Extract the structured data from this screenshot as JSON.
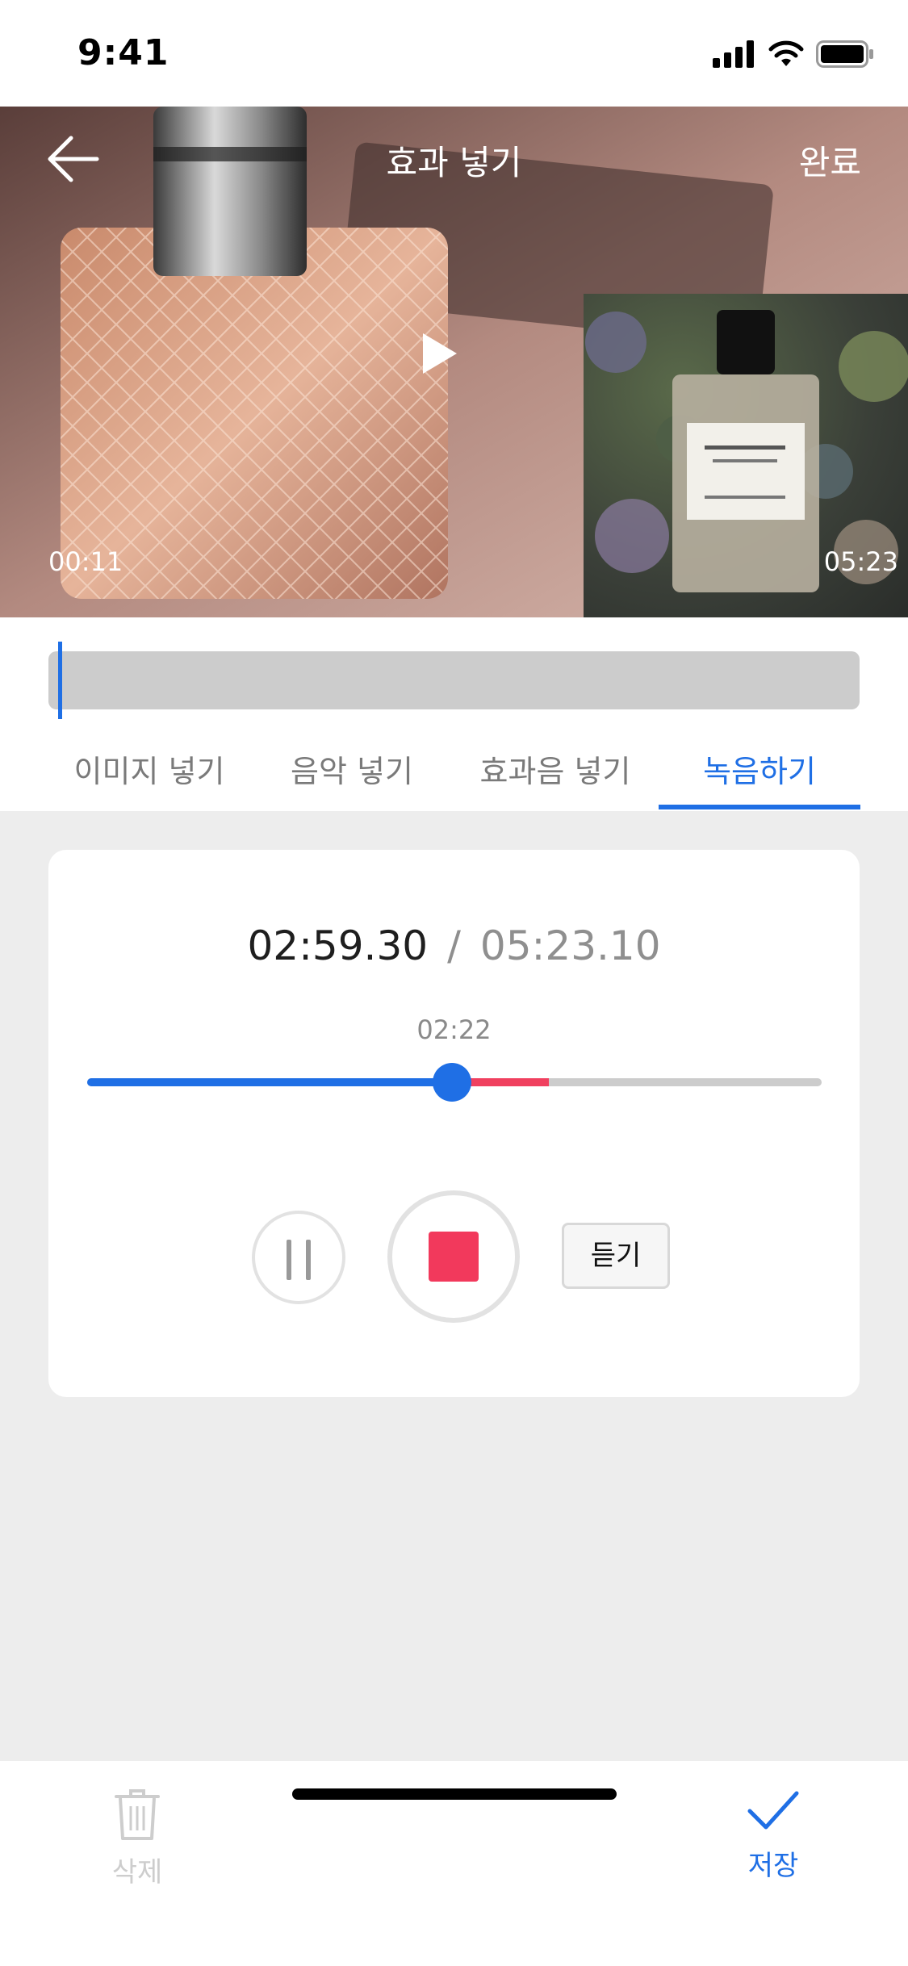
{
  "status_bar": {
    "time": "9:41",
    "icons": [
      "signal-icon",
      "wifi-icon",
      "battery-icon"
    ]
  },
  "header": {
    "title": "효과 넣기",
    "done_label": "완료",
    "back_icon": "back-arrow-icon"
  },
  "video": {
    "current_time": "00:11",
    "thumbnail_time": "05:23"
  },
  "tabs": [
    {
      "label": "이미지 넣기",
      "active": false
    },
    {
      "label": "음악 넣기",
      "active": false
    },
    {
      "label": "효과음 넣기",
      "active": false
    },
    {
      "label": "녹음하기",
      "active": true
    }
  ],
  "recorder": {
    "current_time": "02:59.30",
    "separator": "/",
    "total_time": "05:23.10",
    "slider_label": "02:22",
    "listen_label": "듣기"
  },
  "bottom_bar": {
    "delete_label": "삭제",
    "save_label": "저장"
  },
  "colors": {
    "accent": "#1f6fe5",
    "record": "#f2395c",
    "recorded_segment": "#f0405f",
    "disabled": "#cdcdcd"
  }
}
